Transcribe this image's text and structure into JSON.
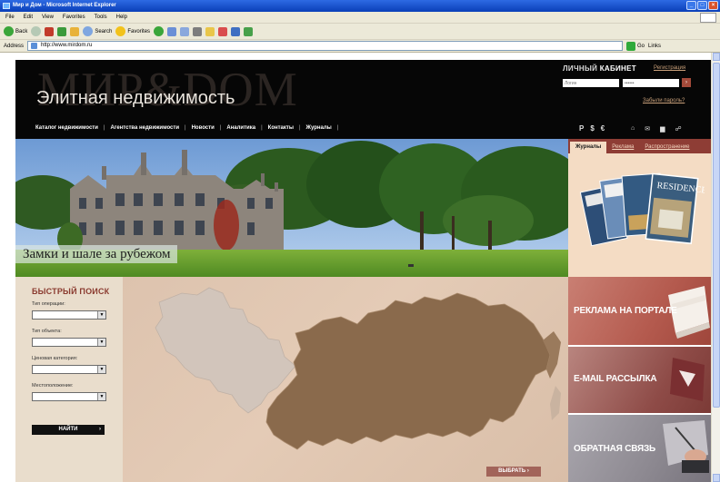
{
  "browser": {
    "title": "Мир и Дом - Microsoft Internet Explorer",
    "menu": [
      "File",
      "Edit",
      "View",
      "Favorites",
      "Tools",
      "Help"
    ],
    "toolbar": {
      "back": "Back",
      "search": "Search",
      "favorites": "Favorites"
    },
    "address_label": "Address",
    "url": "http://www.mirdom.ru",
    "go": "Go",
    "links": "Links"
  },
  "header": {
    "logo_bg": "МИР&DOM",
    "logo_sub": "Элитная недвижимость",
    "cabinet_prefix": "ЛИЧНЫЙ",
    "cabinet_bold": "КАБИНЕТ",
    "register": "Регистрация",
    "login_placeholder": "Логин",
    "password_value": "••••••",
    "login_button": "›",
    "forgot": "Забыли пароль?",
    "nav": [
      "Каталог недвижимости",
      "Агентства недвижимости",
      "Новости",
      "Аналитика",
      "Контакты",
      "Журналы"
    ],
    "currency": [
      "Р",
      "$",
      "€"
    ]
  },
  "banner": {
    "caption": "Замки и шале за рубежом"
  },
  "journals": {
    "tabs": [
      "Журналы",
      "Реклама",
      "Распространение"
    ],
    "mag_title": "RESIDENCE"
  },
  "search": {
    "title": "БЫСТРЫЙ ПОИСК",
    "fields": [
      "Тип операции:",
      "Тип объекта:",
      "Ценовая категория:",
      "Местоположение:"
    ],
    "button": "НАЙТИ",
    "button_arrow": "›"
  },
  "map": {
    "button": "ВЫБРАТЬ",
    "button_arrow": "›"
  },
  "promos": [
    "РЕКЛАМА НА ПОРТАЛЕ",
    "E-MAIL РАССЫЛКА",
    "ОБРАТНАЯ СВЯЗЬ"
  ],
  "colors": {
    "header_bg": "#060606",
    "accent": "#8e3d35",
    "search_title": "#8a3a2f",
    "map_region": "#8a6a4c",
    "map_europe": "#d2c5bb"
  }
}
